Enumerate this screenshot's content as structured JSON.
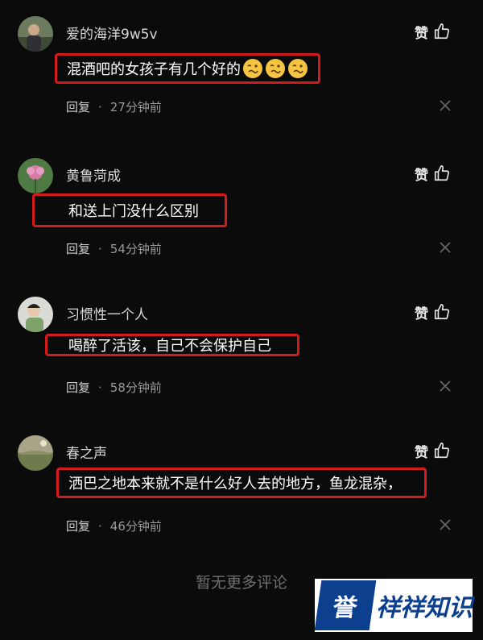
{
  "comments": [
    {
      "username": "爱的海洋9w5v",
      "content": "混酒吧的女孩子有几个好的",
      "emojis": [
        "🥴",
        "🥴",
        "🥴"
      ],
      "reply_label": "回复",
      "time": "27分钟前",
      "like_label": "赞",
      "avatar_icon": "avatar-person-scenery"
    },
    {
      "username": "黄鲁菏成",
      "content": "和送上门没什么区别",
      "emojis": [],
      "reply_label": "回复",
      "time": "54分钟前",
      "like_label": "赞",
      "avatar_icon": "avatar-flower"
    },
    {
      "username": "习惯性一个人",
      "content": "喝醉了活该，自己不会保护自己",
      "emojis": [],
      "reply_label": "回复",
      "time": "58分钟前",
      "like_label": "赞",
      "avatar_icon": "avatar-person-light"
    },
    {
      "username": "春之声",
      "content": "洒巴之地本来就不是什么好人去的地方，鱼龙混杂，",
      "emojis": [],
      "reply_label": "回复",
      "time": "46分钟前",
      "like_label": "赞",
      "avatar_icon": "avatar-landscape"
    }
  ],
  "footer": {
    "no_more_text": "暂无更多评论"
  },
  "watermark": {
    "logo_text": "誉",
    "text": "祥祥知识"
  },
  "colors": {
    "background": "#0b0b0b",
    "highlight_border": "#d31b1b",
    "meta_text": "#9a9a9a",
    "watermark_blue": "#0d3f8f"
  }
}
